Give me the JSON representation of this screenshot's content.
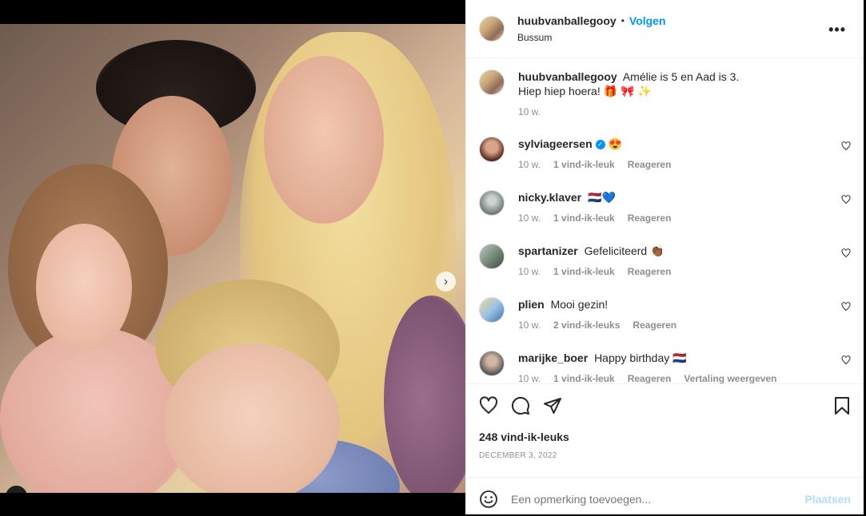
{
  "post": {
    "username": "huubvanballegooy",
    "follow_label": "Volgen",
    "bullet": "•",
    "location": "Bussum",
    "more_label": "•••"
  },
  "caption": {
    "username": "huubvanballegooy",
    "text": "Amélie is 5 en Aad is 3.",
    "text2": "Hiep hiep hoera! 🎁 🎀 ✨",
    "time": "10 w."
  },
  "comments": [
    {
      "username": "sylviageersen",
      "verified": true,
      "text": "😍",
      "time": "10 w.",
      "likes": "1 vind-ik-leuk",
      "reply": "Reageren"
    },
    {
      "username": "nicky.klaver",
      "text": "🇳🇱💙",
      "time": "10 w.",
      "likes": "1 vind-ik-leuk",
      "reply": "Reageren"
    },
    {
      "username": "spartanizer",
      "text": "Gefeliciteerd 👏🏾",
      "time": "10 w.",
      "likes": "1 vind-ik-leuk",
      "reply": "Reageren"
    },
    {
      "username": "plien",
      "text": "Mooi gezin!",
      "time": "10 w.",
      "likes": "2 vind-ik-leuks",
      "reply": "Reageren"
    },
    {
      "username": "marijke_boer",
      "text": "Happy birthday 🇳🇱",
      "time": "10 w.",
      "likes": "1 vind-ik-leuk",
      "reply": "Reageren",
      "translate": "Vertaling weergeven"
    }
  ],
  "actions": {
    "likes": "248 vind-ik-leuks",
    "date": "DECEMBER 3, 2022"
  },
  "add_comment": {
    "placeholder": "Een opmerking toevoegen...",
    "post_label": "Plaatsen"
  },
  "media": {
    "carousel_count": 4,
    "carousel_active": 1
  },
  "colors": {
    "accent": "#0095f6",
    "post_disabled": "#b3dbff",
    "muted": "#8e8e8e"
  }
}
